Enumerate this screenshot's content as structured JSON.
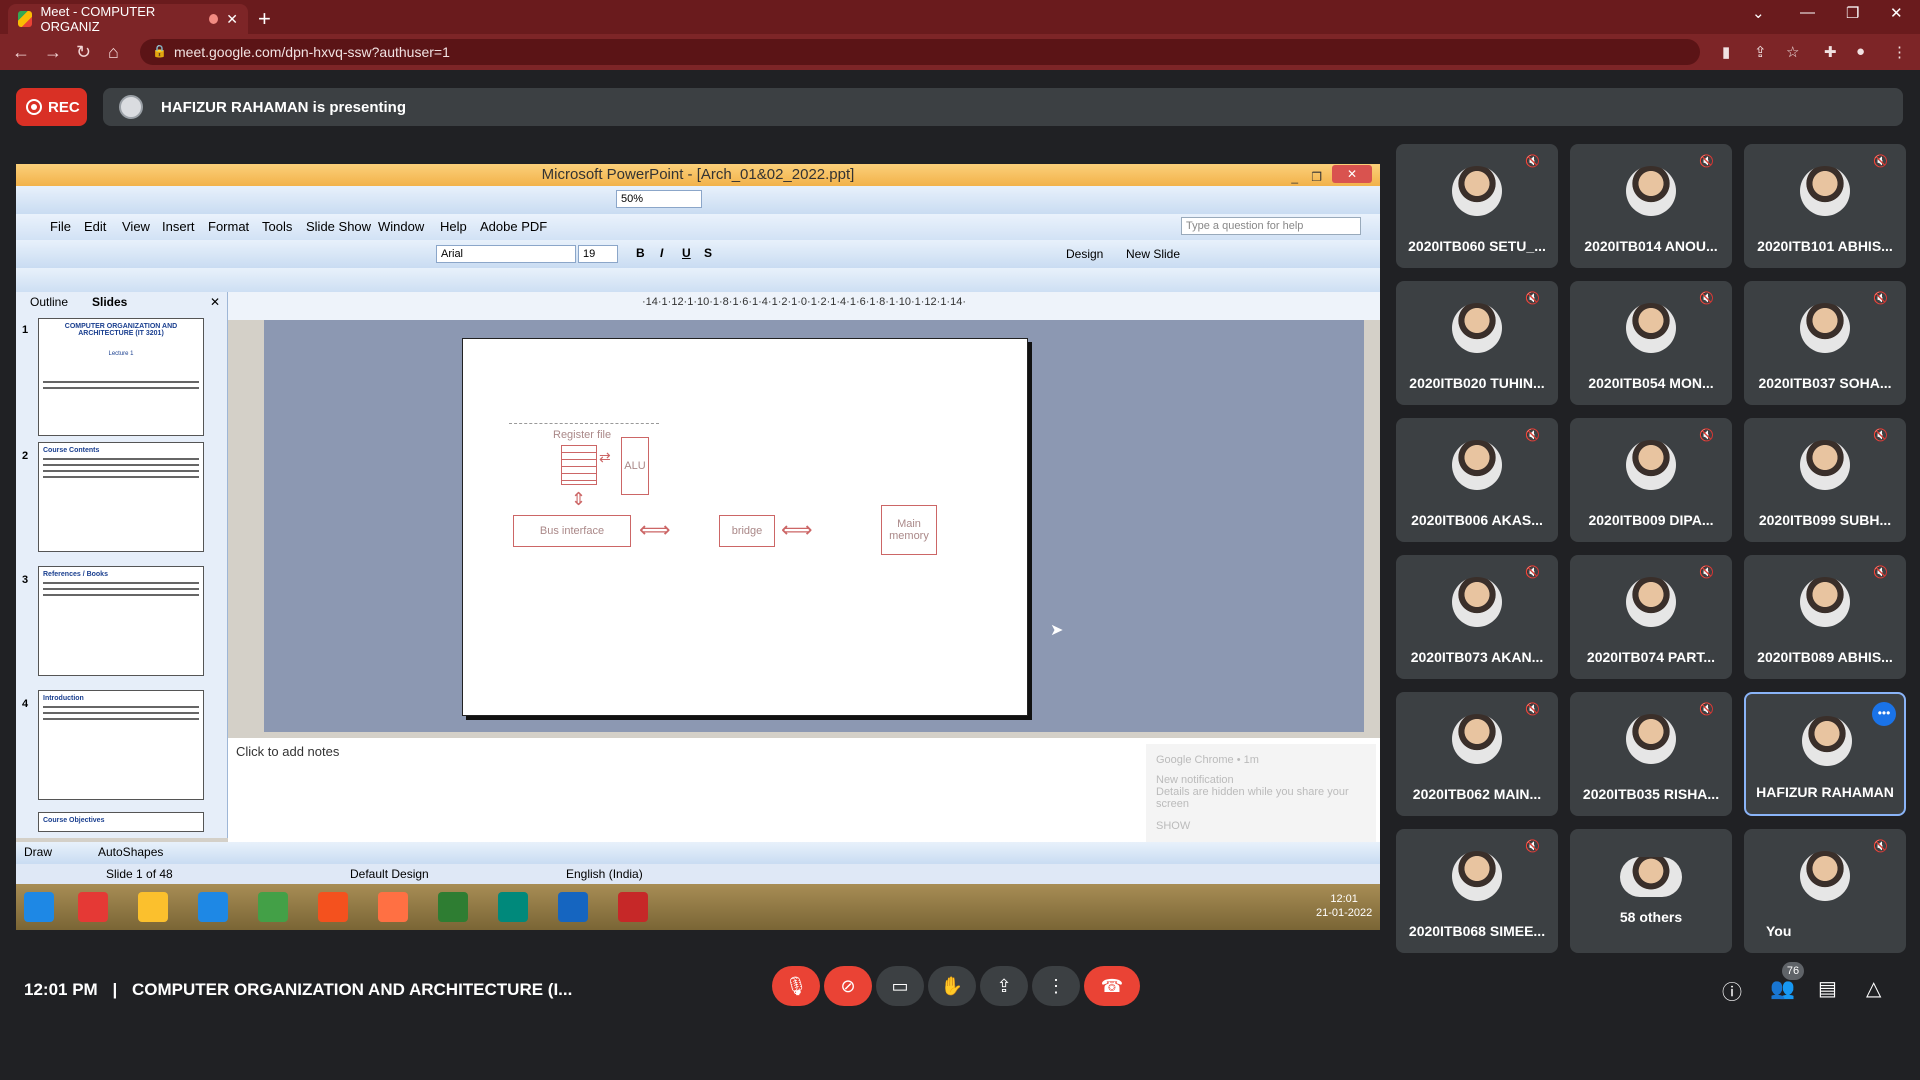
{
  "browser": {
    "tab_title": "Meet - COMPUTER ORGANIZ",
    "url": "meet.google.com/dpn-hxvq-ssw?authuser=1"
  },
  "meet": {
    "rec_label": "REC",
    "presenting_text": "HAFIZUR RAHAMAN is presenting",
    "time": "12:01 PM",
    "separator": "|",
    "meeting_title": "COMPUTER ORGANIZATION AND ARCHITECTURE (I...",
    "people_count": "76"
  },
  "powerpoint": {
    "window_title": "Microsoft PowerPoint - [Arch_01&02_2022.ppt]",
    "zoom": "50%",
    "menu": [
      "File",
      "Edit",
      "View",
      "Insert",
      "Format",
      "Tools",
      "Slide Show",
      "Window",
      "Help",
      "Adobe PDF"
    ],
    "help_placeholder": "Type a question for help",
    "font": "Arial",
    "font_size": "19",
    "design_label": "Design",
    "new_slide_label": "New Slide",
    "tabs": [
      "Outline",
      "Slides"
    ],
    "ruler": "·14·1·12·1·10·1·8·1·6·1·4·1·2·1·0·1·2·1·4·1·6·1·8·1·10·1·12·1·14·",
    "thumbnails": [
      {
        "num": "1",
        "title": "COMPUTER ORGANIZATION AND ARCHITECTURE (IT 3201)",
        "sub": "Lecture 1"
      },
      {
        "num": "2",
        "title": "Course Contents",
        "sub": ""
      },
      {
        "num": "3",
        "title": "References / Books",
        "sub": ""
      },
      {
        "num": "4",
        "title": "Introduction",
        "sub": ""
      },
      {
        "num": "",
        "title": "Course Objectives",
        "sub": ""
      }
    ],
    "diagram": {
      "register_file": "Register file",
      "alu": "ALU",
      "bus_interface": "Bus interface",
      "bridge": "bridge",
      "main_memory": "Main memory"
    },
    "notes_placeholder": "Click to add notes",
    "notification": {
      "app": "Google Chrome • 1m",
      "title": "New notification",
      "body": "Details are hidden while you share your screen",
      "action": "SHOW"
    },
    "draw_label": "Draw",
    "autoshapes_label": "AutoShapes",
    "status_slide": "Slide 1 of 48",
    "status_design": "Default Design",
    "status_lang": "English (India)",
    "tray_time": "12:01",
    "tray_date": "21-01-2022"
  },
  "participants": [
    {
      "name": "2020ITB060 SETU_..."
    },
    {
      "name": "2020ITB014 ANOU..."
    },
    {
      "name": "2020ITB101 ABHIS..."
    },
    {
      "name": "2020ITB020 TUHIN..."
    },
    {
      "name": "2020ITB054 MON..."
    },
    {
      "name": "2020ITB037 SOHA..."
    },
    {
      "name": "2020ITB006 AKAS..."
    },
    {
      "name": "2020ITB009 DIPA..."
    },
    {
      "name": "2020ITB099 SUBH..."
    },
    {
      "name": "2020ITB073 AKAN..."
    },
    {
      "name": "2020ITB074 PART..."
    },
    {
      "name": "2020ITB089 ABHIS..."
    },
    {
      "name": "2020ITB062 MAIN..."
    },
    {
      "name": "2020ITB035 RISHA..."
    },
    {
      "name": "HAFIZUR RAHAMAN"
    },
    {
      "name": "2020ITB068 SIMEE..."
    },
    {
      "name": "58 others"
    },
    {
      "name": "You"
    }
  ],
  "colors": {
    "accent": "#1a73e8",
    "rec_red": "#d93025",
    "tile_bg": "#3c4043",
    "browser_frame": "#6a1b1d"
  }
}
